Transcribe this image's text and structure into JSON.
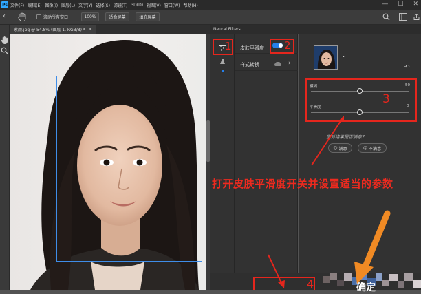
{
  "app": {
    "logo_text": "Ps",
    "menu": [
      "文件(F)",
      "编辑(E)",
      "图像(I)",
      "图层(L)",
      "文字(Y)",
      "选择(S)",
      "滤镜(T)",
      "3D(D)",
      "视图(V)",
      "窗口(W)",
      "帮助(H)"
    ],
    "window_controls": {
      "minimize": "—",
      "restore": "☐",
      "close": "✕"
    }
  },
  "options_bar": {
    "scroll_all_windows_label": "滚动所有窗口",
    "zoom_value": "100%",
    "fit_screen_label": "适合屏幕",
    "fill_screen_label": "填充屏幕"
  },
  "document": {
    "tab_title": "素颜.jpg @ 54.8% (图层 1, RGB/8) *",
    "tab_close": "×"
  },
  "neural_filters": {
    "panel_title": "Neural Filters",
    "filters": [
      {
        "label": "皮肤平滑度",
        "enabled": true
      },
      {
        "label": "样式转换",
        "enabled": false
      }
    ],
    "sliders": [
      {
        "label": "模糊",
        "value": "50",
        "fraction": 0.5
      },
      {
        "label": "平滑度",
        "value": "0",
        "fraction": 0.5
      }
    ],
    "feedback_question": "您对结果是否满意？",
    "feedback_yes": "满意",
    "feedback_no": "不满意",
    "ok_label": "确定"
  },
  "annotations": {
    "num1": "1",
    "num2": "2",
    "num3": "3",
    "num4": "4",
    "instruction": "打开皮肤平滑度开关并设置适当的参数",
    "red_color": "#e5261d",
    "orange_color": "#f08a24"
  },
  "colors": {
    "accent_blue": "#2680eb",
    "face_frame_blue": "#3f8de8"
  }
}
